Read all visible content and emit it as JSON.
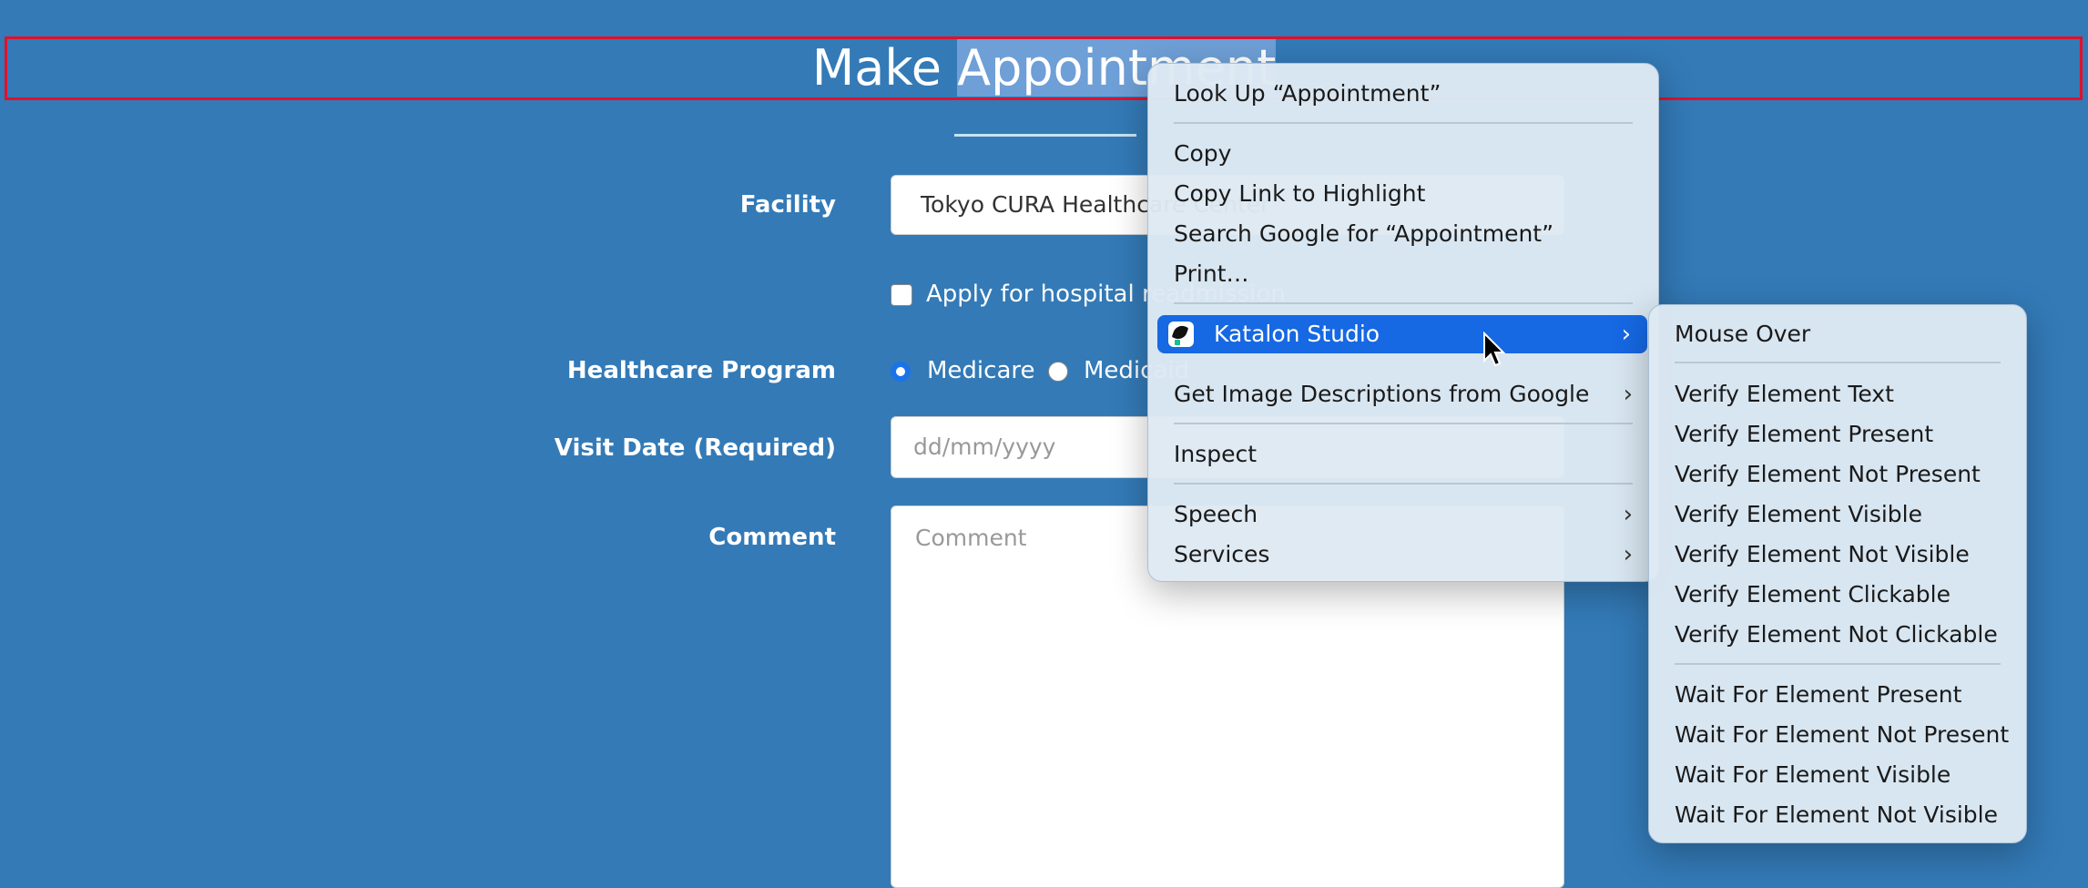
{
  "page": {
    "title_part1": "Make ",
    "title_selected": "Appointment",
    "facility_label": "Facility",
    "facility_value": "Tokyo CURA Healthcare Center",
    "readmission_label": "Apply for hospital readmission",
    "program_label": "Healthcare Program",
    "program_options": [
      "Medicare",
      "Medicaid"
    ],
    "visit_date_label": "Visit Date (Required)",
    "visit_date_placeholder": "dd/mm/yyyy",
    "comment_label": "Comment",
    "comment_placeholder": "Comment"
  },
  "context_menu": {
    "items": [
      "Look Up “Appointment”",
      "Copy",
      "Copy Link to Highlight",
      "Search Google for “Appointment”",
      "Print…",
      "Katalon Studio",
      "Get Image Descriptions from Google",
      "Inspect",
      "Speech",
      "Services"
    ],
    "chevron": "›"
  },
  "submenu": {
    "items": [
      "Mouse Over",
      "Verify Element Text",
      "Verify Element Present",
      "Verify Element Not Present",
      "Verify Element Visible",
      "Verify Element Not Visible",
      "Verify Element Clickable",
      "Verify Element Not Clickable",
      "Wait For Element Present",
      "Wait For Element Not Present",
      "Wait For Element Visible",
      "Wait For Element Not Visible"
    ]
  },
  "colors": {
    "page_bg": "#337ab7",
    "highlight_border": "#e0112b",
    "menu_active": "#1668e3",
    "radio_selected": "#1a73e8"
  }
}
